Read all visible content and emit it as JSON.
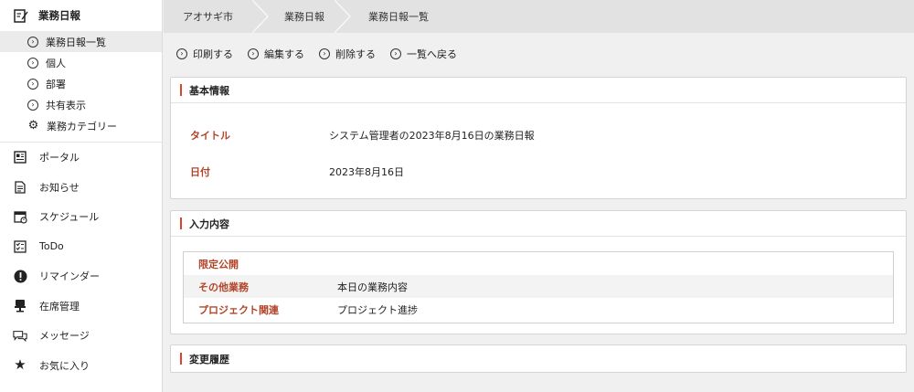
{
  "sidebar": {
    "section_title": "業務日報",
    "sub_items": [
      {
        "label": "業務日報一覧",
        "active": true,
        "icon": "circle-chevron-icon"
      },
      {
        "label": "個人",
        "active": false,
        "icon": "circle-chevron-icon"
      },
      {
        "label": "部署",
        "active": false,
        "icon": "circle-chevron-icon"
      },
      {
        "label": "共有表示",
        "active": false,
        "icon": "circle-chevron-icon"
      },
      {
        "label": "業務カテゴリー",
        "active": false,
        "icon": "gear-icon"
      }
    ],
    "nav": [
      {
        "label": "ポータル",
        "icon": "portal-icon"
      },
      {
        "label": "お知らせ",
        "icon": "notice-icon"
      },
      {
        "label": "スケジュール",
        "icon": "calendar-icon"
      },
      {
        "label": "ToDo",
        "icon": "checklist-icon"
      },
      {
        "label": "リマインダー",
        "icon": "exclamation-icon"
      },
      {
        "label": "在席管理",
        "icon": "seat-icon"
      },
      {
        "label": "メッセージ",
        "icon": "message-icon"
      },
      {
        "label": "お気に入り",
        "icon": "star-icon"
      }
    ]
  },
  "breadcrumb": [
    "アオサギ市",
    "業務日報",
    "業務日報一覧"
  ],
  "toolbar": [
    "印刷する",
    "編集する",
    "削除する",
    "一覧へ戻る"
  ],
  "basic_info": {
    "title": "基本情報",
    "title_label": "タイトル",
    "title_value": "システム管理者の2023年8月16日の業務日報",
    "date_label": "日付",
    "date_value": "2023年8月16日"
  },
  "input_content": {
    "title": "入力内容",
    "rows": [
      {
        "label": "限定公開",
        "value": ""
      },
      {
        "label": "その他業務",
        "value": "本日の業務内容"
      },
      {
        "label": "プロジェクト関連",
        "value": "プロジェクト進捗"
      }
    ]
  },
  "history": {
    "title": "変更履歴"
  },
  "colors": {
    "accent": "#d9462c",
    "label_red": "#b3442a",
    "breadcrumb_bg": "#e2e2e2",
    "page_bg": "#f0f0f0"
  }
}
